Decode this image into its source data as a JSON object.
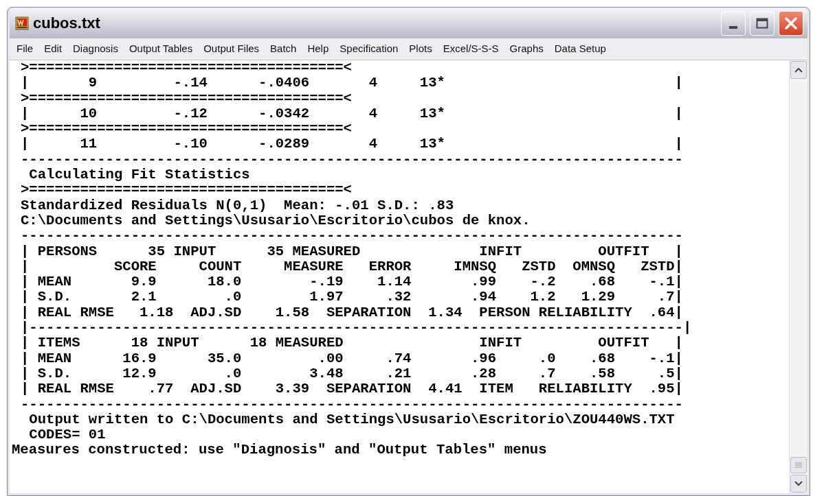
{
  "window": {
    "title": "cubos.txt"
  },
  "menu": [
    "File",
    "Edit",
    "Diagnosis",
    "Output Tables",
    "Output Files",
    "Batch",
    "Help",
    "Specification",
    "Plots",
    "Excel/S-S-S",
    "Graphs",
    "Data Setup"
  ],
  "console": {
    "lines": [
      {
        "kind": "output",
        "text": ">=====================================<"
      },
      {
        "kind": "output",
        "text": "|       9         -.14      -.0406       4     13*                           |"
      },
      {
        "kind": "output",
        "text": ">=====================================<"
      },
      {
        "kind": "output",
        "text": "|      10         -.12      -.0342       4     13*                           |"
      },
      {
        "kind": "output",
        "text": ">=====================================<"
      },
      {
        "kind": "output",
        "text": "|      11         -.10      -.0289       4     13*                           |"
      },
      {
        "kind": "output",
        "text": "------------------------------------------------------------------------------"
      },
      {
        "kind": "output",
        "text": " Calculating Fit Statistics"
      },
      {
        "kind": "output",
        "text": ">=====================================<"
      },
      {
        "kind": "output",
        "text": "Standardized Residuals N(0,1)  Mean: -.01 S.D.: .83"
      },
      {
        "kind": "output",
        "text": "C:\\Documents and Settings\\Ususario\\Escritorio\\cubos de knox."
      },
      {
        "kind": "output",
        "text": "------------------------------------------------------------------------------"
      },
      {
        "kind": "output",
        "text": "| PERSONS      35 INPUT      35 MEASURED              INFIT         OUTFIT   |"
      },
      {
        "kind": "output",
        "text": "|          SCORE     COUNT     MEASURE   ERROR     IMNSQ   ZSTD  OMNSQ   ZSTD|"
      },
      {
        "kind": "output",
        "text": "| MEAN       9.9      18.0        -.19    1.14       .99    -.2    .68    -.1|"
      },
      {
        "kind": "output",
        "text": "| S.D.       2.1        .0        1.97     .32       .94    1.2   1.29     .7|"
      },
      {
        "kind": "output",
        "text": "| REAL RMSE   1.18  ADJ.SD    1.58  SEPARATION  1.34  PERSON RELIABILITY  .64|"
      },
      {
        "kind": "output",
        "text": "|-----------------------------------------------------------------------------|"
      },
      {
        "kind": "output",
        "text": "| ITEMS      18 INPUT      18 MEASURED                INFIT         OUTFIT   |"
      },
      {
        "kind": "output",
        "text": "| MEAN      16.9      35.0         .00     .74       .96     .0    .68    -.1|"
      },
      {
        "kind": "output",
        "text": "| S.D.      12.9        .0        3.48     .21       .28     .7    .58     .5|"
      },
      {
        "kind": "output",
        "text": "| REAL RMSE    .77  ADJ.SD    3.39  SEPARATION  4.41  ITEM   RELIABILITY  .95|"
      },
      {
        "kind": "output",
        "text": "------------------------------------------------------------------------------"
      },
      {
        "kind": "output",
        "text": " Output written to C:\\Documents and Settings\\Ususario\\Escritorio\\ZOU440WS.TXT"
      },
      {
        "kind": "output",
        "text": " CODES= 01"
      },
      {
        "kind": "message",
        "text": "Measures constructed: use \"Diagnosis\" and \"Output Tables\" menus"
      }
    ]
  }
}
